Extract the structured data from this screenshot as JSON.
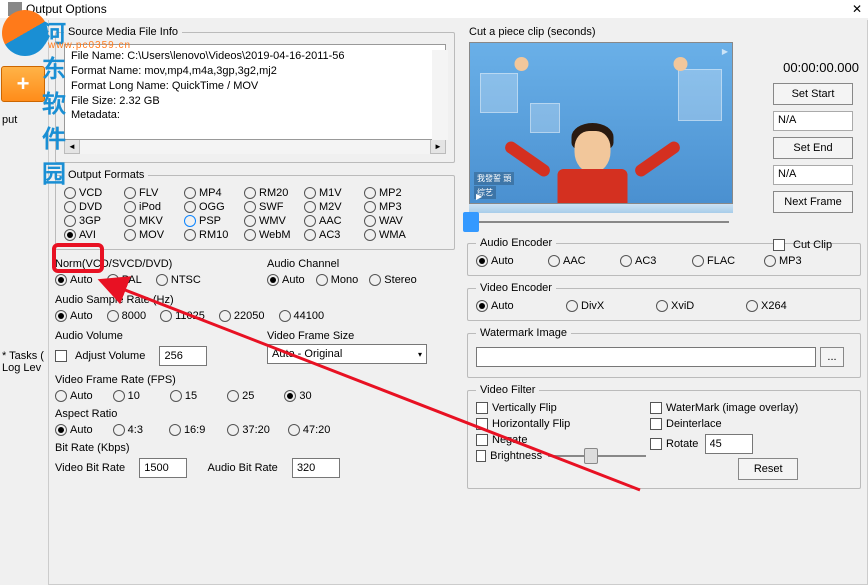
{
  "window": {
    "title": "Output Options"
  },
  "watermark": {
    "text": "河东软件园",
    "sub": "www.pc0359.cn"
  },
  "left": {
    "input_label": "put",
    "tasks": "* Tasks (",
    "log": "Log Lev"
  },
  "info": {
    "legend": "Source Media File Info",
    "line1": "File Name: C:\\Users\\lenovo\\Videos\\2019-04-16-2011-56",
    "line2": "Format Name: mov,mp4,m4a,3gp,3g2,mj2",
    "line3": "Format Long Name: QuickTime / MOV",
    "line4": "File Size: 2.32 GB",
    "line5": "Metadata:"
  },
  "formats": {
    "legend": "Output Formats",
    "r1": [
      "VCD",
      "FLV",
      "MP4",
      "RM20",
      "M1V",
      "MP2"
    ],
    "r2": [
      "DVD",
      "iPod",
      "OGG",
      "SWF",
      "M2V",
      "MP3"
    ],
    "r3": [
      "3GP",
      "MKV",
      "PSP",
      "WMV",
      "AAC",
      "WAV"
    ],
    "r4": [
      "AVI",
      "MOV",
      "RM10",
      "WebM",
      "AC3",
      "WMA"
    ]
  },
  "norm": {
    "label": "Norm(VCD/SVCD/DVD)",
    "opts": [
      "Auto",
      "PAL",
      "NTSC"
    ]
  },
  "achan": {
    "label": "Audio Channel",
    "opts": [
      "Auto",
      "Mono",
      "Stereo"
    ]
  },
  "srate": {
    "label": "Audio Sample Rate (Hz)",
    "opts": [
      "Auto",
      "8000",
      "11025",
      "22050",
      "44100"
    ]
  },
  "avolume": {
    "label": "Audio Volume",
    "adj": "Adjust Volume",
    "val": "256"
  },
  "vfsize": {
    "label": "Video Frame Size",
    "sel": "Auto - Original"
  },
  "vfrate": {
    "label": "Video Frame Rate (FPS)",
    "opts": [
      "Auto",
      "10",
      "15",
      "25",
      "30"
    ]
  },
  "aspect": {
    "label": "Aspect Ratio",
    "opts": [
      "Auto",
      "4:3",
      "16:9",
      "37:20",
      "47:20"
    ]
  },
  "bitrate": {
    "label": "Bit Rate (Kbps)",
    "vlabel": "Video Bit Rate",
    "vval": "1500",
    "alabel": "Audio Bit Rate",
    "aval": "320"
  },
  "cut": {
    "label": "Cut a piece clip (seconds)",
    "time": "00:00:00.000",
    "set_start": "Set Start",
    "na": "N/A",
    "set_end": "Set End",
    "next_frame": "Next Frame",
    "cut_clip": "Cut Clip"
  },
  "aenc": {
    "label": "Audio Encoder",
    "opts": [
      "Auto",
      "AAC",
      "AC3",
      "FLAC",
      "MP3"
    ]
  },
  "venc": {
    "label": "Video Encoder",
    "opts": [
      "Auto",
      "DivX",
      "XviD",
      "X264"
    ]
  },
  "wm": {
    "label": "Watermark Image",
    "browse": "..."
  },
  "vfilter": {
    "label": "Video Filter",
    "vflip": "Vertically Flip",
    "hflip": "Horizontally Flip",
    "negate": "Negate",
    "bright": "Brightness",
    "watermark": "WaterMark (image overlay)",
    "deint": "Deinterlace",
    "rotate": "Rotate",
    "rval": "45",
    "reset": "Reset"
  },
  "preview_tags": {
    "corner": "▶",
    "bl": "综艺",
    "bl2": "我發誓 頭"
  }
}
